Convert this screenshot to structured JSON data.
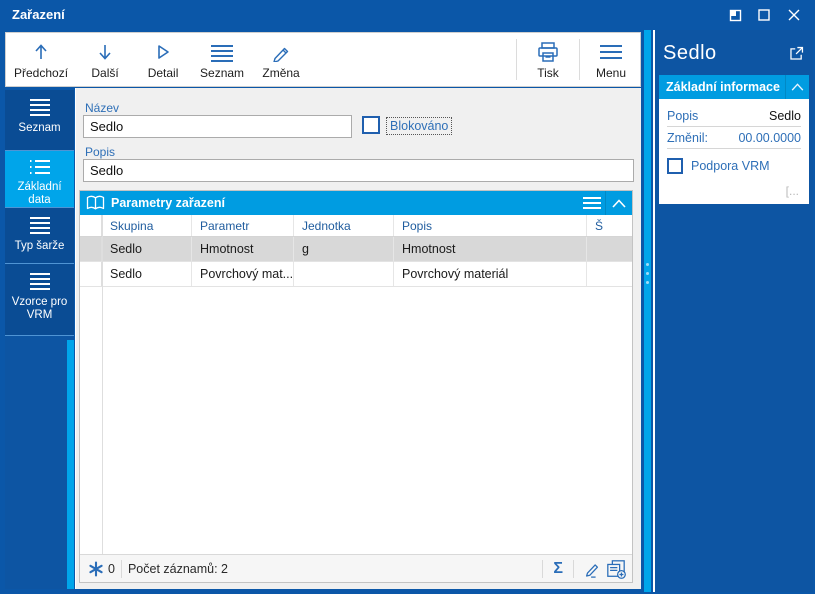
{
  "window": {
    "title": "Zařazení"
  },
  "toolbar": {
    "buttons": [
      {
        "label": "Předchozí"
      },
      {
        "label": "Další"
      },
      {
        "label": "Detail"
      },
      {
        "label": "Seznam"
      },
      {
        "label": "Změna"
      }
    ],
    "print_label": "Tisk",
    "menu_label": "Menu"
  },
  "sidebar": {
    "tabs": [
      {
        "label": "Seznam"
      },
      {
        "label": "Základní data"
      },
      {
        "label": "Typ šarže"
      },
      {
        "label": "Vzorce pro VRM"
      }
    ]
  },
  "form": {
    "nazev_label": "Název",
    "nazev_value": "Sedlo",
    "blokovano_label": "Blokováno",
    "popis_label": "Popis",
    "popis_value": "Sedlo"
  },
  "panel": {
    "title": "Parametry zařazení",
    "columns": {
      "skupina": "Skupina",
      "parametr": "Parametr",
      "jednotka": "Jednotka",
      "popis": "Popis",
      "sarze": "Š"
    },
    "rows": [
      {
        "skupina": "Sedlo",
        "parametr": "Hmotnost",
        "jednotka": "g",
        "popis": "Hmotnost",
        "sarze": ""
      },
      {
        "skupina": "Sedlo",
        "parametr": "Povrchový mat...",
        "jednotka": "",
        "popis": "Povrchový materiál",
        "sarze": ""
      }
    ],
    "status": {
      "changes_count": "0",
      "records_text": "Počet záznamů: 2",
      "sigma_glyph": "Σ"
    }
  },
  "right_panel": {
    "title": "Sedlo",
    "section_title": "Základní informace",
    "popis_label": "Popis",
    "popis_value": "Sedlo",
    "zmenil_label": "Změnil:",
    "zmenil_value": "00.00.0000",
    "checkbox_label": "Podpora VRM",
    "more_indicator": "[..."
  },
  "colors": {
    "chrome_blue": "#0b57a8",
    "accent_cyan": "#00a5ea",
    "header_cyan": "#009ce1",
    "icon_blue": "#2a6db8",
    "label_blue": "#2e6fb7",
    "selected_row": "#d8d8d8"
  }
}
